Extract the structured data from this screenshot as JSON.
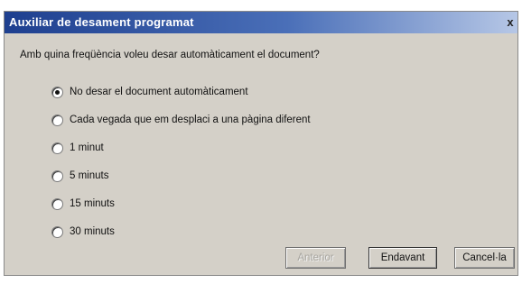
{
  "window": {
    "title": "Auxiliar de desament programat",
    "close_label": "x"
  },
  "prompt": "Amb quina freqüència voleu desar automàticament el document?",
  "options": [
    {
      "label": "No desar el document automàticament",
      "checked": true
    },
    {
      "label": "Cada vegada que em desplaci a una pàgina diferent",
      "checked": false
    },
    {
      "label": "1 minut",
      "checked": false
    },
    {
      "label": "5 minuts",
      "checked": false
    },
    {
      "label": "15 minuts",
      "checked": false
    },
    {
      "label": "30 minuts",
      "checked": false
    }
  ],
  "buttons": {
    "back": "Anterior",
    "next": "Endavant",
    "cancel": "Cancel·la"
  },
  "colors": {
    "dialog_bg": "#d4d0c8",
    "title_start": "#1e3f8f",
    "title_end": "#b6c7e6",
    "title_text": "#ffffff"
  }
}
